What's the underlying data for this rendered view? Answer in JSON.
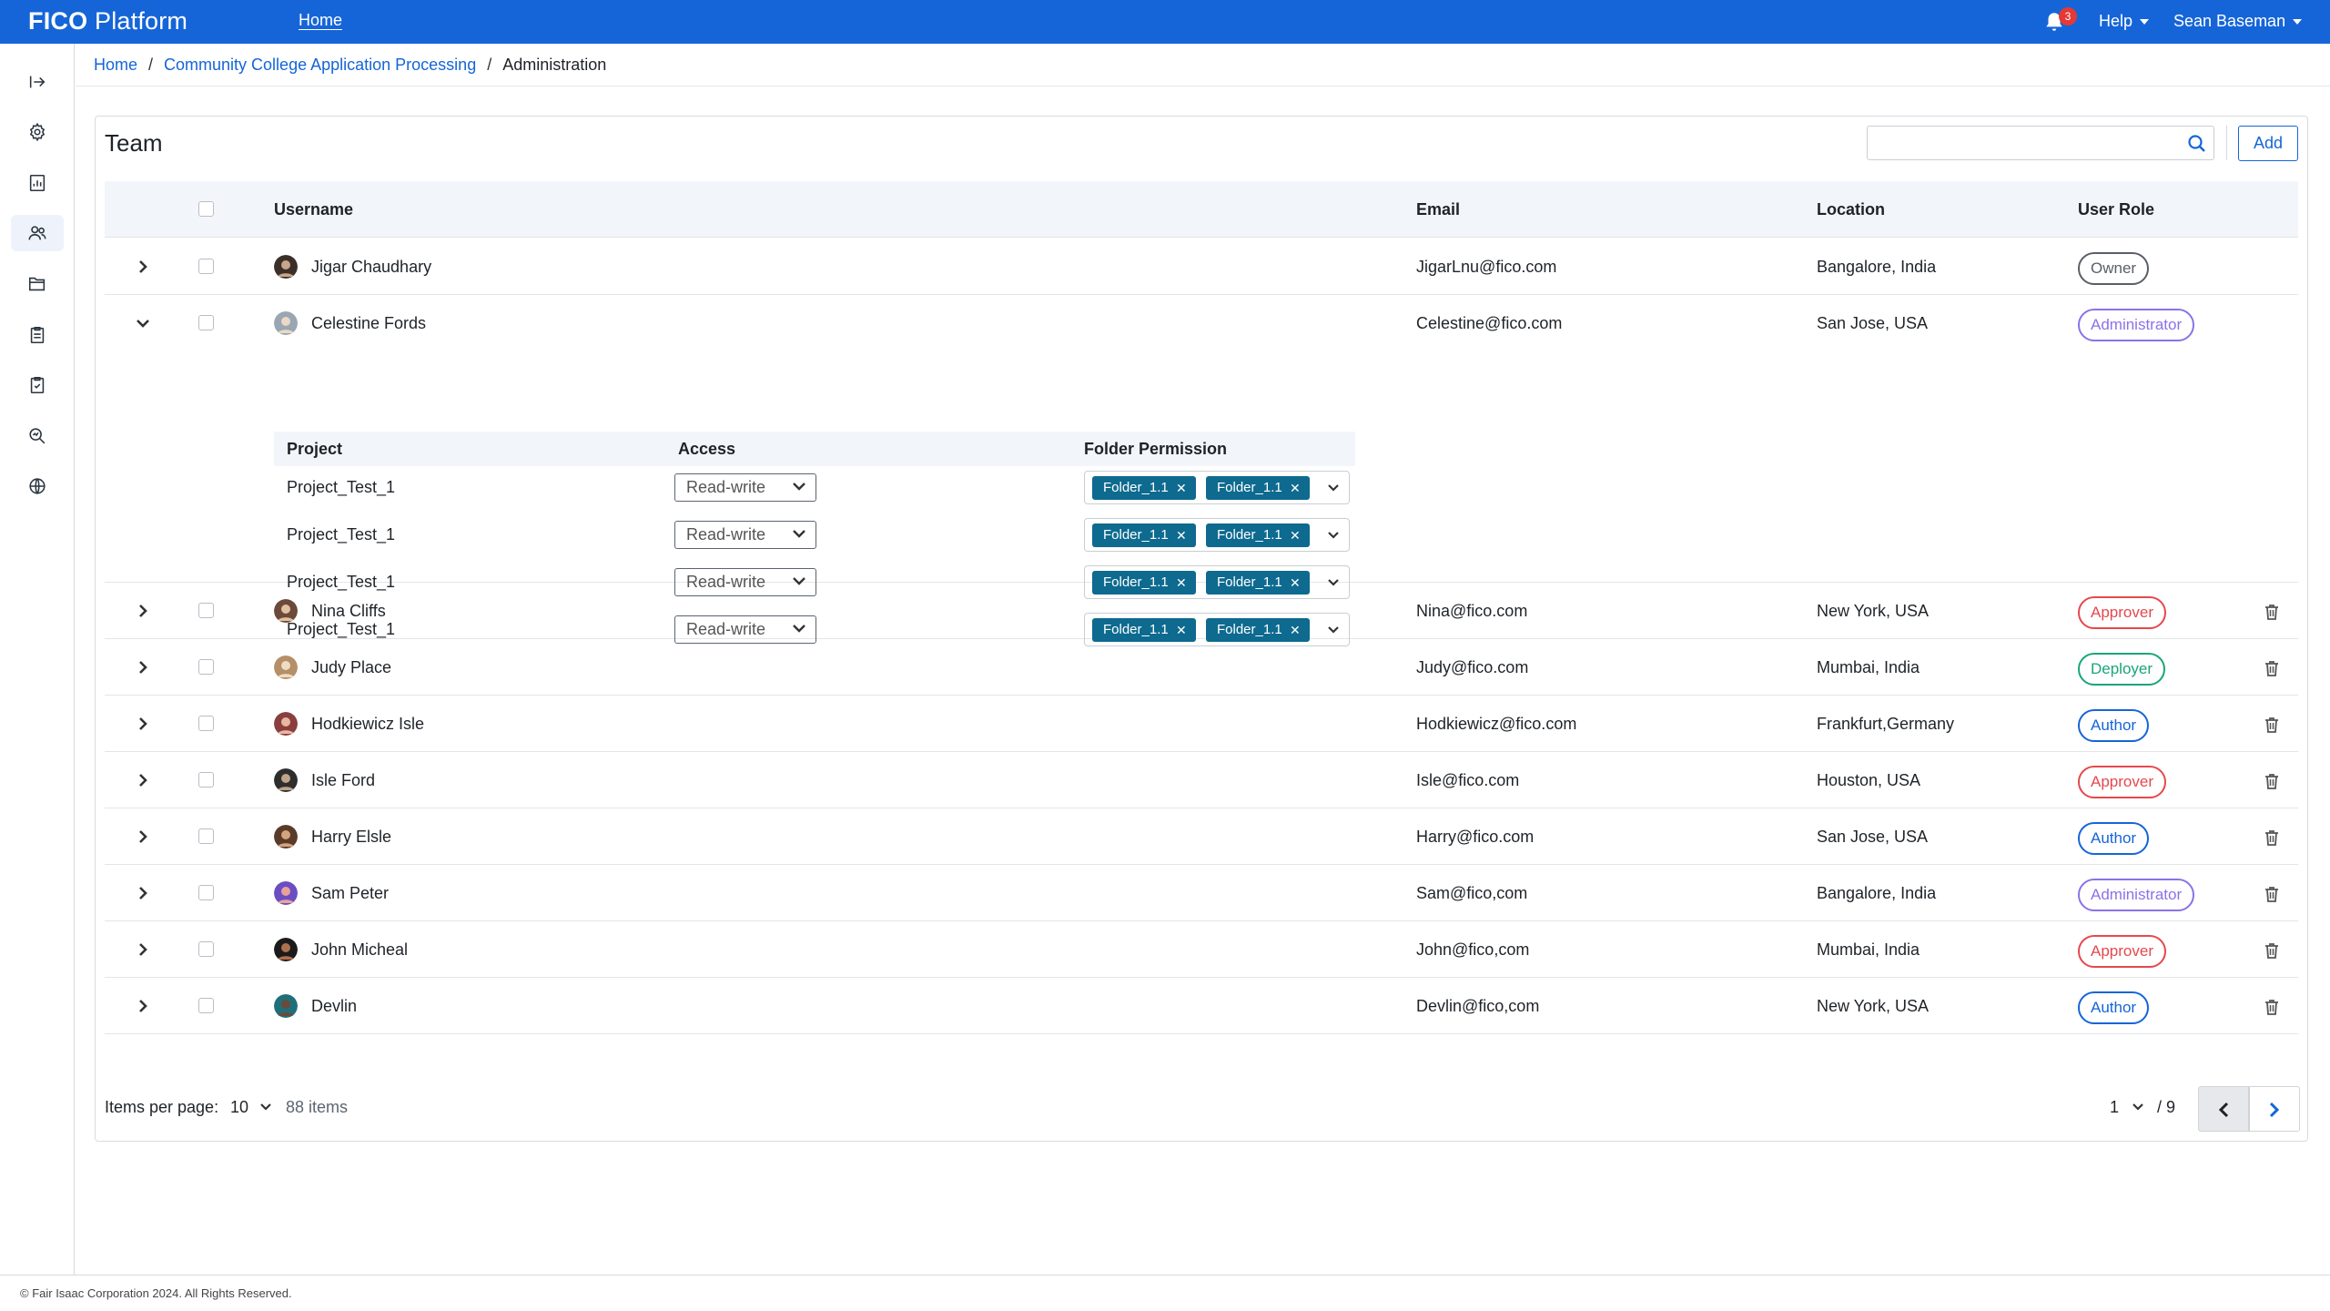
{
  "header": {
    "brand_bold": "FICO",
    "brand_rest": "Platform",
    "nav_home": "Home",
    "notification_count": "3",
    "help": "Help",
    "user": "Sean Baseman"
  },
  "sidebar": {
    "items": [
      {
        "icon": "expand-sidebar-icon"
      },
      {
        "icon": "settings-icon"
      },
      {
        "icon": "report-icon"
      },
      {
        "icon": "team-icon",
        "active": true
      },
      {
        "icon": "folder-icon"
      },
      {
        "icon": "clipboard-icon"
      },
      {
        "icon": "checklist-icon"
      },
      {
        "icon": "search-analysis-icon"
      },
      {
        "icon": "globe-icon"
      }
    ]
  },
  "breadcrumb": {
    "home": "Home",
    "project": "Community College Application Processing",
    "current": "Administration",
    "separator": "/"
  },
  "team": {
    "title": "Team",
    "search_placeholder": "",
    "add_label": "Add",
    "columns": {
      "username": "Username",
      "email": "Email",
      "location": "Location",
      "role": "User Role"
    },
    "rows": [
      {
        "name": "Jigar Chaudhary",
        "email": "JigarLnu@fico.com",
        "location": "Bangalore, India",
        "role": "Owner",
        "role_color": "#5a5f66",
        "trash": false,
        "expanded": false
      },
      {
        "name": "Celestine Fords",
        "email": "Celestine@fico.com",
        "location": "San Jose, USA",
        "role": "Administrator",
        "role_color": "#8b72e8",
        "trash": false,
        "expanded": true
      },
      {
        "name": "Nina Cliffs",
        "email": "Nina@fico.com",
        "location": "New York, USA",
        "role": "Approver",
        "role_color": "#e5484d",
        "trash": true
      },
      {
        "name": "Judy Place",
        "email": "Judy@fico.com",
        "location": "Mumbai, India",
        "role": "Deployer",
        "role_color": "#18a57a",
        "trash": true
      },
      {
        "name": "Hodkiewicz Isle",
        "email": "Hodkiewicz@fico.com",
        "location": "Frankfurt,Germany",
        "role": "Author",
        "role_color": "#1565d8",
        "trash": true
      },
      {
        "name": "Isle Ford",
        "email": "Isle@fico.com",
        "location": "Houston, USA",
        "role": "Approver",
        "role_color": "#e5484d",
        "trash": true
      },
      {
        "name": "Harry Elsle",
        "email": "Harry@fico.com",
        "location": "San Jose, USA",
        "role": "Author",
        "role_color": "#1565d8",
        "trash": true
      },
      {
        "name": "Sam Peter",
        "email": "Sam@fico,com",
        "location": "Bangalore, India",
        "role": "Administrator",
        "role_color": "#8b72e8",
        "trash": true
      },
      {
        "name": "John Micheal",
        "email": "John@fico,com",
        "location": "Mumbai, India",
        "role": "Approver",
        "role_color": "#e5484d",
        "trash": true
      },
      {
        "name": "Devlin",
        "email": "Devlin@fico,com",
        "location": "New York, USA",
        "role": "Author",
        "role_color": "#1565d8",
        "trash": true
      }
    ],
    "expanded_detail": {
      "columns": {
        "project": "Project",
        "access": "Access",
        "folder": "Folder Permission"
      },
      "rows": [
        {
          "project": "Project_Test_1",
          "access": "Read-write",
          "folders": [
            "Folder_1.1",
            "Folder_1.1"
          ]
        },
        {
          "project": "Project_Test_1",
          "access": "Read-write",
          "folders": [
            "Folder_1.1",
            "Folder_1.1"
          ]
        },
        {
          "project": "Project_Test_1",
          "access": "Read-write",
          "folders": [
            "Folder_1.1",
            "Folder_1.1"
          ]
        },
        {
          "project": "Project_Test_1",
          "access": "Read-write",
          "folders": [
            "Folder_1.1",
            "Folder_1.1"
          ]
        }
      ]
    }
  },
  "pagination": {
    "items_per_page_label": "Items per page:",
    "items_per_page": "10",
    "total_items": "88 items",
    "current_page": "1",
    "total_pages": "/ 9"
  },
  "footer": {
    "copyright": "© Fair Isaac Corporation 2024. All Rights Reserved."
  },
  "colors": {
    "brand_blue": "#1565d8",
    "chip_teal": "#0e6a8f",
    "header_bg": "#f2f6fb"
  }
}
